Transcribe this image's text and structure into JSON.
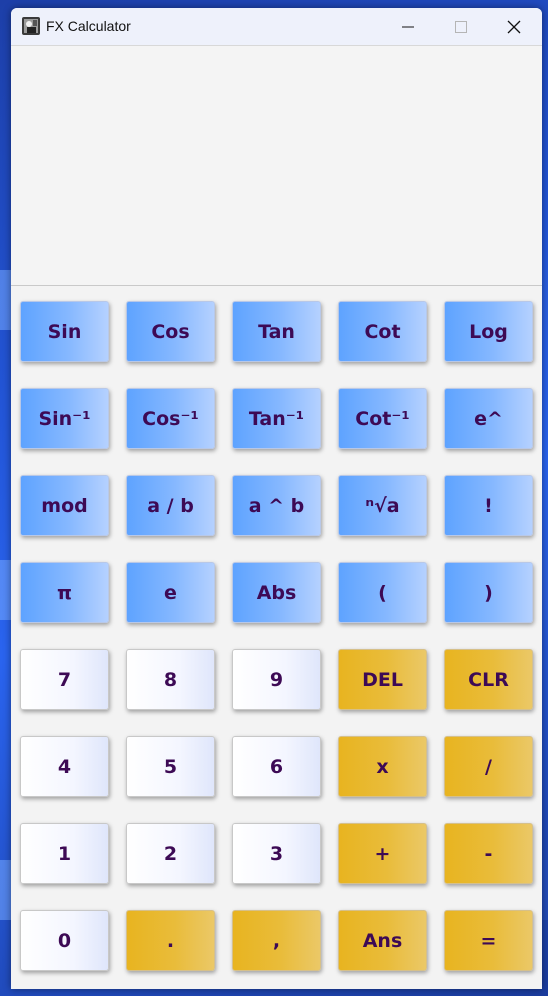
{
  "window": {
    "title": "FX Calculator",
    "icon": "app-photo-icon",
    "controls": [
      "minimize-icon",
      "maximize-icon",
      "close-icon"
    ]
  },
  "display": {
    "expression": "",
    "result": ""
  },
  "colors": {
    "blue_key_start": "#5ea3ff",
    "blue_key_end": "#b5d1ff",
    "gold_key": "#e8b420",
    "white_key": "#ffffff",
    "key_text": "#3d0a55"
  },
  "keys": [
    [
      {
        "label": "Sin",
        "name": "sin-button"
      },
      {
        "label": "Cos",
        "name": "cos-button"
      },
      {
        "label": "Tan",
        "name": "tan-button"
      },
      {
        "label": "Cot",
        "name": "cot-button"
      },
      {
        "label": "Log",
        "name": "log-button"
      }
    ],
    [
      {
        "label": "Sin⁻¹",
        "name": "arcsin-button"
      },
      {
        "label": "Cos⁻¹",
        "name": "arccos-button"
      },
      {
        "label": "Tan⁻¹",
        "name": "arctan-button"
      },
      {
        "label": "Cot⁻¹",
        "name": "arccot-button"
      },
      {
        "label": "e^",
        "name": "exp-button"
      }
    ],
    [
      {
        "label": "mod",
        "name": "mod-button"
      },
      {
        "label": "a / b",
        "name": "fraction-button"
      },
      {
        "label": "a ^ b",
        "name": "power-button"
      },
      {
        "label": "ⁿ√a",
        "name": "nth-root-button"
      },
      {
        "label": "!",
        "name": "factorial-button"
      }
    ],
    [
      {
        "label": "π",
        "name": "pi-button"
      },
      {
        "label": "e",
        "name": "euler-button"
      },
      {
        "label": "Abs",
        "name": "abs-button"
      },
      {
        "label": "(",
        "name": "open-paren-button"
      },
      {
        "label": ")",
        "name": "close-paren-button"
      }
    ],
    [
      {
        "label": "7",
        "name": "digit-7-button"
      },
      {
        "label": "8",
        "name": "digit-8-button"
      },
      {
        "label": "9",
        "name": "digit-9-button"
      },
      {
        "label": "DEL",
        "name": "delete-button"
      },
      {
        "label": "CLR",
        "name": "clear-button"
      }
    ],
    [
      {
        "label": "4",
        "name": "digit-4-button"
      },
      {
        "label": "5",
        "name": "digit-5-button"
      },
      {
        "label": "6",
        "name": "digit-6-button"
      },
      {
        "label": "x",
        "name": "multiply-button"
      },
      {
        "label": "/",
        "name": "divide-button"
      }
    ],
    [
      {
        "label": "1",
        "name": "digit-1-button"
      },
      {
        "label": "2",
        "name": "digit-2-button"
      },
      {
        "label": "3",
        "name": "digit-3-button"
      },
      {
        "label": "+",
        "name": "add-button"
      },
      {
        "label": "-",
        "name": "subtract-button"
      }
    ],
    [
      {
        "label": "0",
        "name": "digit-0-button"
      },
      {
        "label": ".",
        "name": "decimal-point-button"
      },
      {
        "label": ",",
        "name": "comma-button"
      },
      {
        "label": "Ans",
        "name": "answer-button"
      },
      {
        "label": "=",
        "name": "equals-button"
      }
    ]
  ]
}
